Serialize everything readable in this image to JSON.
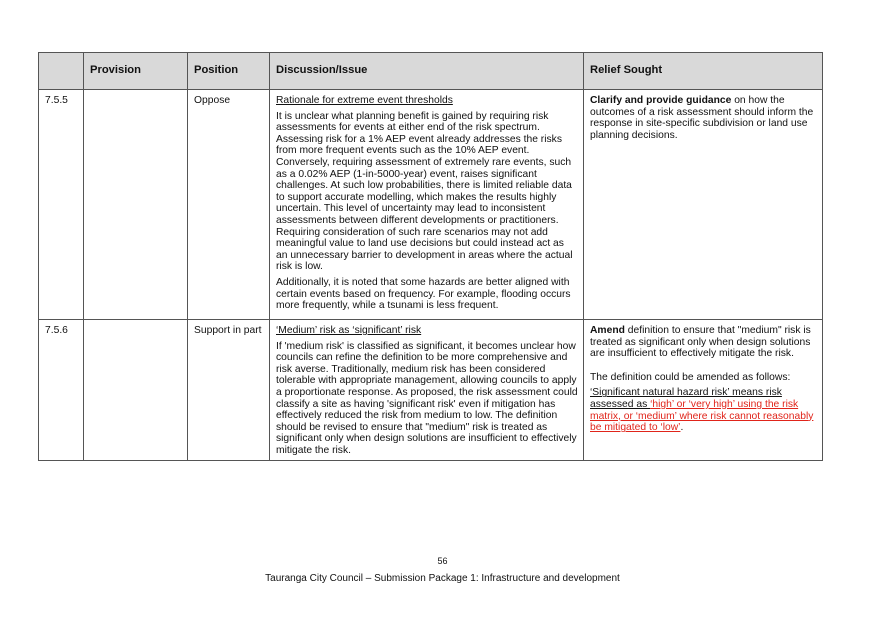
{
  "table": {
    "headers": {
      "ref": "",
      "provision": "Provision",
      "position": "Position",
      "discussion": "Discussion/Issue",
      "relief": "Relief Sought"
    },
    "rows": [
      {
        "ref": "7.5.5",
        "provision": "",
        "position": "Oppose",
        "discussion_heading": "Rationale for extreme event thresholds",
        "discussion_p1": "It is unclear what planning benefit is gained by requiring risk assessments for events at either end of the risk spectrum. Assessing risk for a 1% AEP event already addresses the risks from more frequent events such as the 10% AEP event. Conversely, requiring assessment of extremely rare events, such as a 0.02% AEP (1-in-5000-year) event, raises significant challenges. At such low probabilities, there is limited reliable data to support accurate modelling, which makes the results highly uncertain. This level of uncertainty may lead to inconsistent assessments between different developments or practitioners. Requiring consideration of such rare scenarios may not add meaningful value to land use decisions but could instead act as an unnecessary barrier to development in areas where the actual risk is low.",
        "discussion_p2": "Additionally, it is noted that some hazards are better aligned with certain events based on frequency. For example, flooding occurs more frequently, while a tsunami is less frequent.",
        "relief_bold": "Clarify and provide guidance",
        "relief_text": " on how the outcomes of a risk assessment should inform the response in site-specific subdivision or land use planning decisions."
      },
      {
        "ref": "7.5.6",
        "provision": "",
        "position": "Support in part",
        "discussion_heading": "‘Medium’ risk as ‘significant’ risk",
        "discussion_p1": "If 'medium risk' is classified as significant, it becomes unclear how councils can refine the definition to be more comprehensive and risk averse. Traditionally, medium risk has been considered tolerable with appropriate management, allowing councils to apply a proportionate response. As proposed, the risk assessment could classify a site as having 'significant risk' even if mitigation has effectively reduced the risk from medium to low. The definition should be revised to ensure that \"medium\" risk is treated as significant only when design solutions are insufficient to effectively mitigate the risk.",
        "relief_bold": "Amend",
        "relief_text": " definition to ensure that \"medium\" risk is treated as significant only when design solutions are insufficient to effectively mitigate the risk.",
        "relief_p2": "The definition could be amended as follows:",
        "relief_def_start": "‘Significant natural hazard risk’ means risk assessed as ",
        "relief_def_red": "‘high’ or ‘very high’ using the risk matrix, or ‘medium’ where risk cannot reasonably be mitigated to ‘low’",
        "relief_def_end": "."
      }
    ]
  },
  "footer": {
    "page_number": "56",
    "text": "Tauranga City Council – Submission Package 1: Infrastructure and development"
  }
}
